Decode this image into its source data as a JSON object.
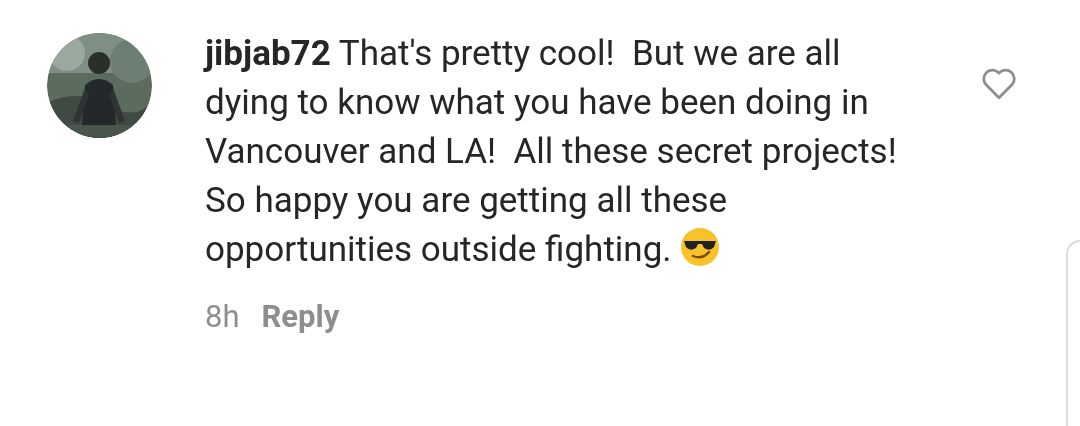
{
  "comment": {
    "username": "jibjab72",
    "text": "That's pretty cool!  But we are all dying to know what you have been doing in Vancouver and LA!  All these secret projects!  So happy you are getting all these opportunities outside fighting.",
    "time": "8h",
    "reply_label": "Reply",
    "liked": false
  }
}
